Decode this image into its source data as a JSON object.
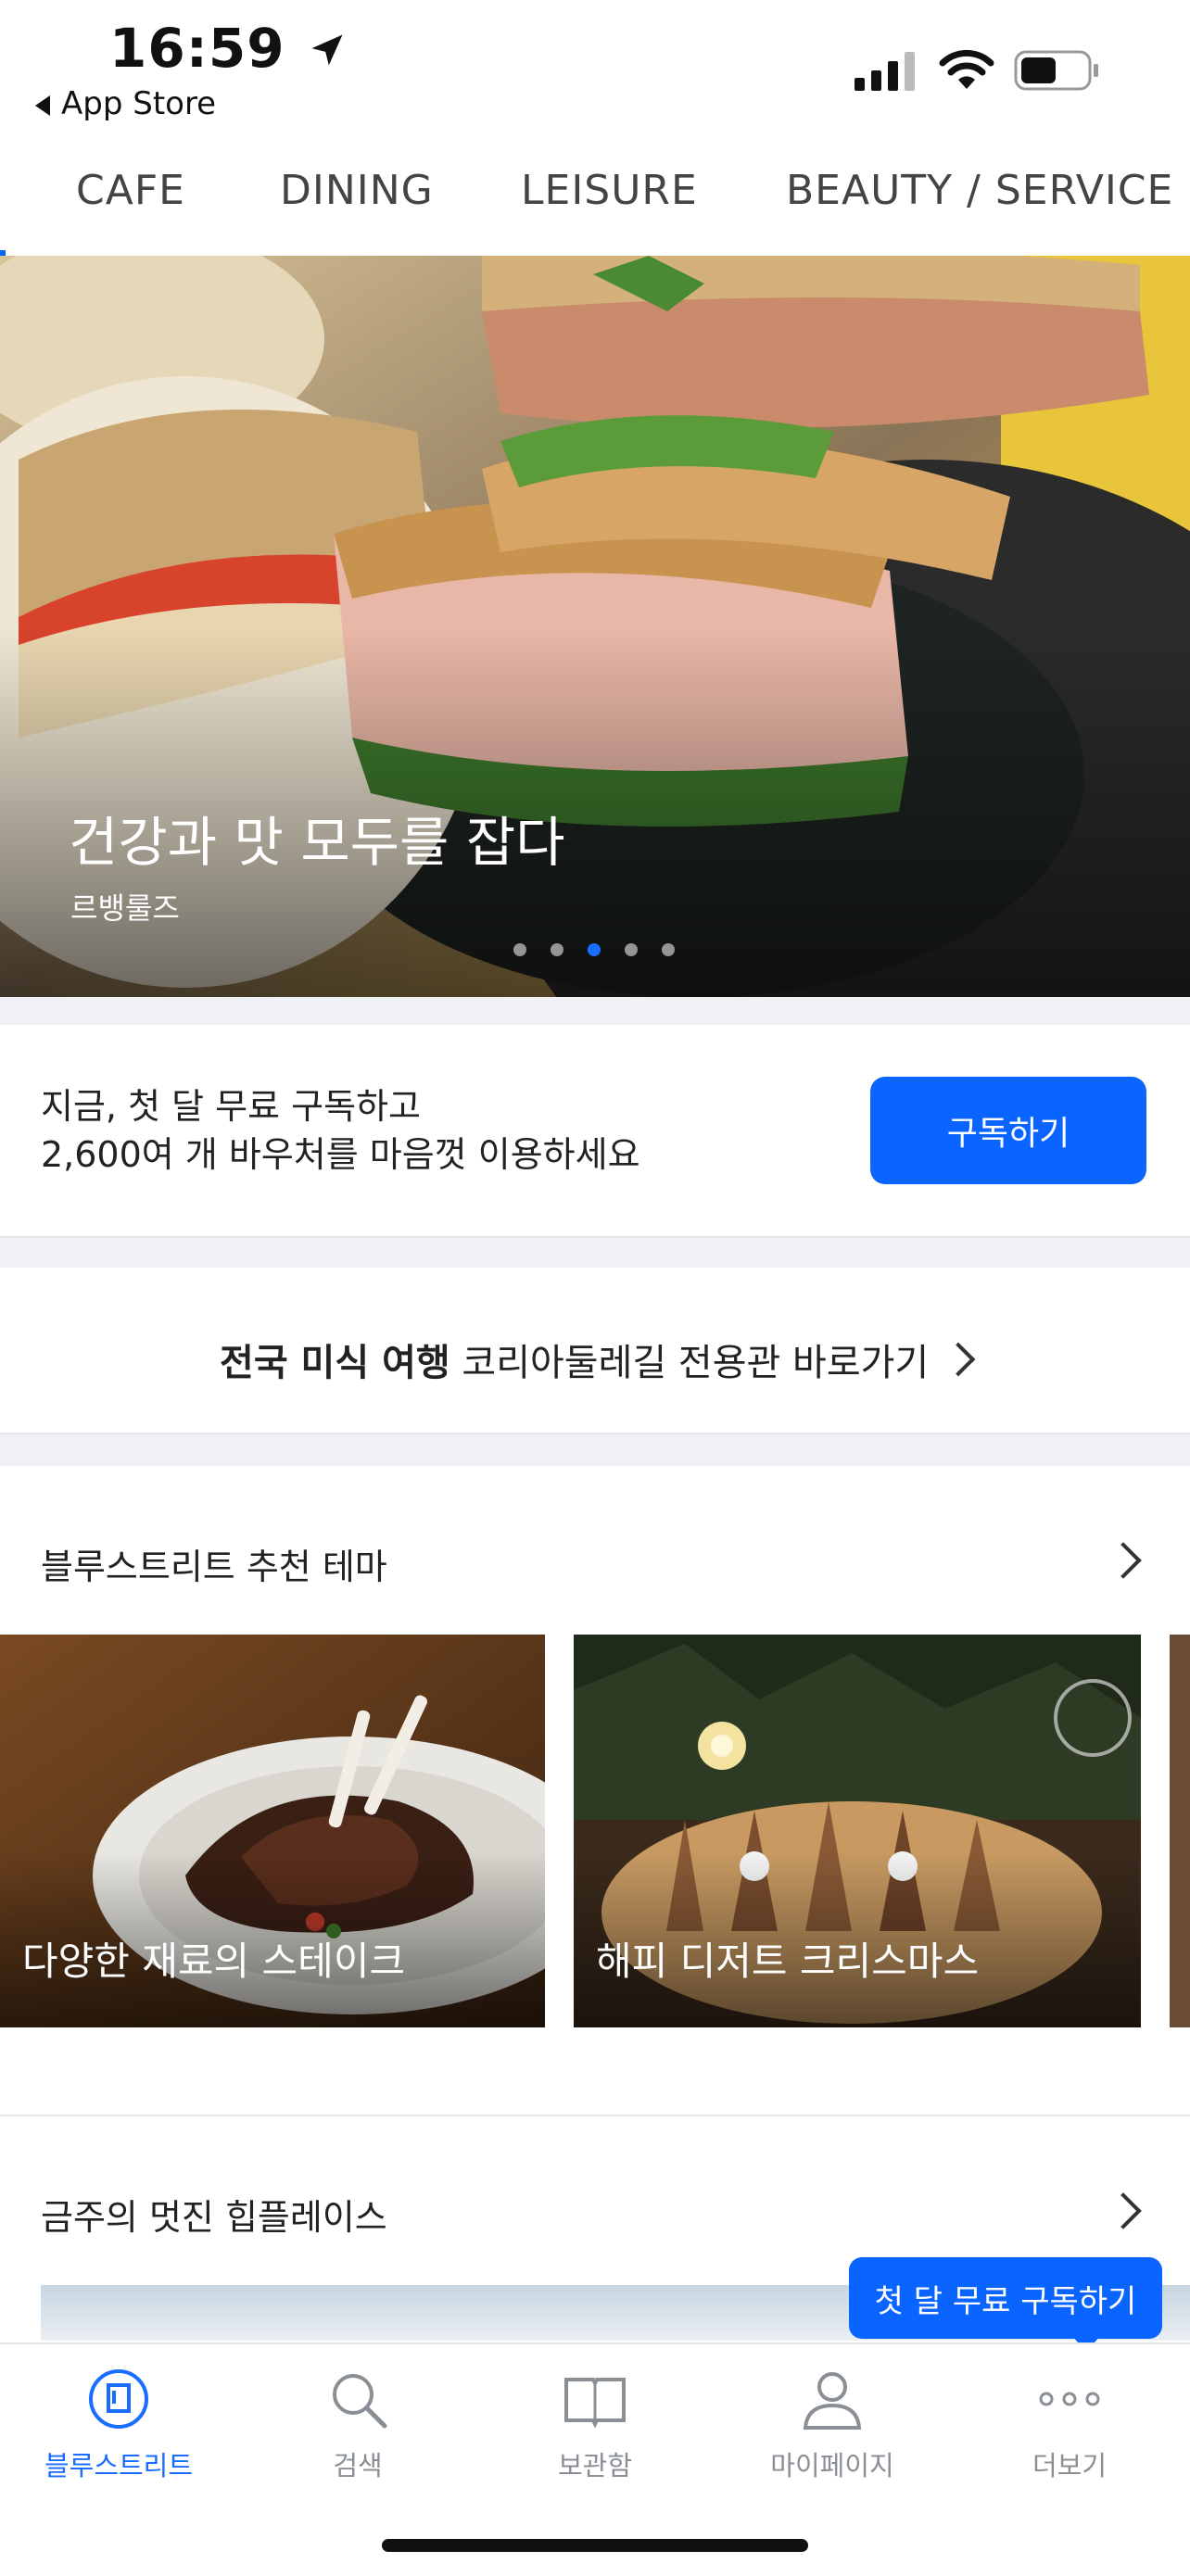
{
  "status_bar": {
    "time": "16:59",
    "back_label": "App Store",
    "battery_level": 0.55
  },
  "tabs": [
    {
      "label": "CAFE"
    },
    {
      "label": "DINING"
    },
    {
      "label": "LEISURE"
    },
    {
      "label": "BEAUTY / SERVICE"
    }
  ],
  "hero": {
    "title": "건강과 맛 모두를 잡다",
    "subtitle": "르뱅룰즈",
    "slide_index": 3,
    "slide_count": 5
  },
  "promo": {
    "line1": "지금, 첫 달 무료 구독하고",
    "line2": "2,600여 개 바우처를 마음껏 이용하세요",
    "button_label": "구독하기"
  },
  "korea_banner": {
    "bold": "전국 미식 여행",
    "text": "코리아둘레길 전용관 바로가기"
  },
  "themes": {
    "title": "블루스트리트 추천 테마",
    "cards": [
      {
        "label": "다양한 재료의 스테이크"
      },
      {
        "label": "해피 디저트 크리스마스"
      }
    ]
  },
  "hot_places": {
    "title": "금주의 멋진 힙플레이스"
  },
  "floating_cta": {
    "label": "첫 달 무료 구독하기"
  },
  "bottom_nav": [
    {
      "label": "블루스트리트",
      "icon": "bluestreet-icon",
      "active": true
    },
    {
      "label": "검색",
      "icon": "search-icon",
      "active": false
    },
    {
      "label": "보관함",
      "icon": "book-icon",
      "active": false
    },
    {
      "label": "마이페이지",
      "icon": "person-icon",
      "active": false
    },
    {
      "label": "더보기",
      "icon": "more-icon",
      "active": false
    }
  ],
  "colors": {
    "accent": "#0a64ff",
    "separator": "#f0f1f4",
    "nav_inactive": "#8a8f96"
  }
}
